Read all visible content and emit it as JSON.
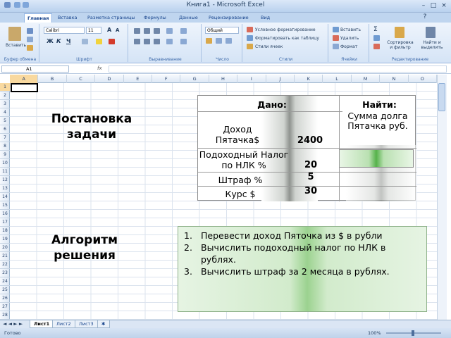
{
  "window": {
    "title": "Книга1 - Microsoft Excel"
  },
  "ribbon_tabs": [
    "Главная",
    "Вставка",
    "Разметка страницы",
    "Формулы",
    "Данные",
    "Рецензирование",
    "Вид"
  ],
  "ribbon": {
    "paste_label": "Вставить",
    "clipboard_label": "Буфер обмена",
    "font_name": "Calibri",
    "font_size": "11",
    "font_group_label": "Шрифт",
    "bold": "Ж",
    "italic": "К",
    "underline": "Ч",
    "align_group_label": "Выравнивание",
    "number_format": "Общий",
    "number_group_label": "Число",
    "styles_items": [
      "Условное форматирование",
      "Форматировать как таблицу",
      "Стили ячеек"
    ],
    "styles_group_label": "Стили",
    "cells_items": [
      "Вставить",
      "Удалить",
      "Формат"
    ],
    "cells_group_label": "Ячейки",
    "sort_label": "Сортировка и фильтр",
    "find_label": "Найти и выделить",
    "editing_group_label": "Редактирование"
  },
  "formula_bar": {
    "name_box": "A1",
    "fx": "fx",
    "value": ""
  },
  "columns": [
    "A",
    "B",
    "C",
    "D",
    "E",
    "F",
    "G",
    "H",
    "I",
    "J",
    "K",
    "L",
    "M",
    "N",
    "O"
  ],
  "rows": [
    "1",
    "2",
    "3",
    "4",
    "5",
    "6",
    "7",
    "8",
    "9",
    "10",
    "11",
    "12",
    "13",
    "14",
    "15",
    "16",
    "17",
    "18",
    "19",
    "20",
    "21",
    "22",
    "23",
    "24",
    "25",
    "26",
    "27",
    "28"
  ],
  "sheet_tabs": [
    "Лист1",
    "Лист2",
    "Лист3"
  ],
  "status": {
    "text": "Готово",
    "zoom": "100%"
  },
  "slide": {
    "heading_problem": "Постановка задачи",
    "heading_algorithm": "Алгоритм решения",
    "given_header": "Дано:",
    "find_header": "Найти:",
    "given_rows": [
      {
        "label": "Доход Пятачка$",
        "value": "2400"
      },
      {
        "label": "Подоходный Налог по НЛК %",
        "value": "20"
      },
      {
        "label": "Штраф %",
        "value": "5"
      },
      {
        "label": "Курс $",
        "value": "30"
      }
    ],
    "find_label": "Сумма долга Пятачка руб.",
    "algorithm_steps": [
      {
        "n": "1.",
        "text": "Перевести доход Пяточка из $ в рубли"
      },
      {
        "n": "2.",
        "text": "Вычислить подоходный налог по НЛК в рублях."
      },
      {
        "n": "3.",
        "text": "Вычислить штраф за 2 месяца в рублях."
      }
    ]
  }
}
